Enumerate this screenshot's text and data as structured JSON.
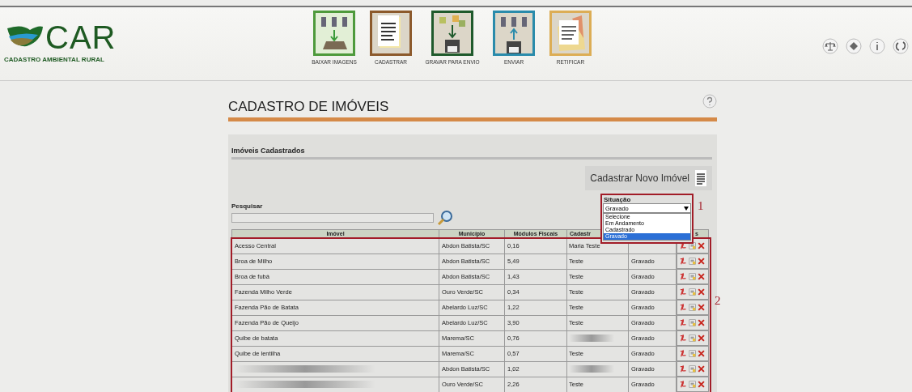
{
  "logo": {
    "title": "CAR",
    "subtitle": "CADASTRO AMBIENTAL RURAL"
  },
  "nav": [
    {
      "label": "BAIXAR IMAGENS",
      "color": "#4e9a3c",
      "kind": "download"
    },
    {
      "label": "CADASTRAR",
      "color": "#8c5a2c",
      "kind": "register"
    },
    {
      "label": "GRAVAR PARA ENVIO",
      "color": "#1f5a2c",
      "kind": "save"
    },
    {
      "label": "ENVIAR",
      "color": "#2a8bab",
      "kind": "send"
    },
    {
      "label": "RETIFICAR",
      "color": "#dcad55",
      "kind": "rectify"
    }
  ],
  "page_title": "CADASTRO DE IMÓVEIS",
  "section_title": "Imóveis Cadastrados",
  "new_button": "Cadastrar Novo Imóvel",
  "search": {
    "label": "Pesquisar"
  },
  "status_filter": {
    "label": "Situação",
    "value": "Gravado",
    "options": [
      {
        "label": "Selecione",
        "selected": false
      },
      {
        "label": "Em Andamento",
        "selected": false
      },
      {
        "label": "Cadastrado",
        "selected": false
      },
      {
        "label": "Gravado",
        "selected": true
      }
    ]
  },
  "annotations": [
    "1",
    "2"
  ],
  "table": {
    "columns": [
      "Imóvel",
      "Município",
      "Módulos Fiscais",
      "Cadastr",
      "",
      "s"
    ],
    "rows": [
      {
        "imovel": "Acesso Central",
        "municipio": "Abdon Batista/SC",
        "modulos": "0,16",
        "cadastrante": "Maria Teste"
      },
      {
        "imovel": "Broa de Milho",
        "municipio": "Abdon Batista/SC",
        "modulos": "5,49",
        "cadastrante": "Teste",
        "situacao": "Gravado"
      },
      {
        "imovel": "Broa de fubá",
        "municipio": "Abdon Batista/SC",
        "modulos": "1,43",
        "cadastrante": "Teste",
        "situacao": "Gravado"
      },
      {
        "imovel": "Fazenda Milho Verde",
        "municipio": "Ouro Verde/SC",
        "modulos": "0,34",
        "cadastrante": "Teste",
        "situacao": "Gravado"
      },
      {
        "imovel": "Fazenda Pão de Batata",
        "municipio": "Abelardo Luz/SC",
        "modulos": "1,22",
        "cadastrante": "Teste",
        "situacao": "Gravado"
      },
      {
        "imovel": "Fazenda Pão de Queijo",
        "municipio": "Abelardo Luz/SC",
        "modulos": "3,90",
        "cadastrante": "Teste",
        "situacao": "Gravado"
      },
      {
        "imovel": "Quibe de batata",
        "municipio": "Marema/SC",
        "modulos": "0,76",
        "cadastrante": null,
        "situacao": "Gravado"
      },
      {
        "imovel": "Quibe de lentilha",
        "municipio": "Marema/SC",
        "modulos": "0,57",
        "cadastrante": "Teste",
        "situacao": "Gravado"
      },
      {
        "imovel": null,
        "municipio": "Abdon Batista/SC",
        "modulos": "1,02",
        "cadastrante": null,
        "situacao": "Gravado"
      },
      {
        "imovel": null,
        "municipio": "Ouro Verde/SC",
        "modulos": "2,26",
        "cadastrante": "Teste",
        "situacao": "Gravado"
      }
    ]
  }
}
